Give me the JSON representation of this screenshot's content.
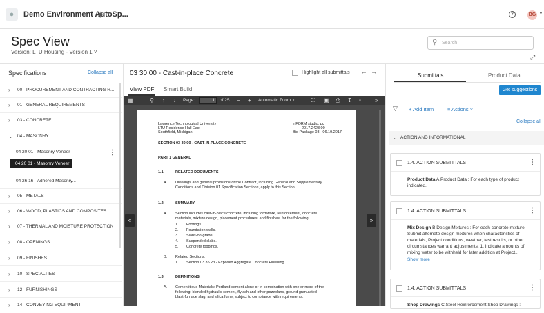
{
  "topbar": {
    "app_title": "Demo Environment AutoSp...",
    "avatar_initials": "BG"
  },
  "page": {
    "title": "Spec View",
    "version": "Version: LTU Housing - Version 1",
    "search_placeholder": "Search"
  },
  "left": {
    "heading": "Specifications",
    "collapse_all": "Collapse all",
    "items": [
      "00 - PROCUREMENT AND CONTRACTING R...",
      "01 - GENERAL REQUIREMENTS",
      "03 - CONCRETE",
      "04 - MASONRY",
      "04 20 01 - Masonry Veneer",
      "04 26 16 - Adhered Masonry...",
      "05 - METALS",
      "06 - WOOD, PLASTICS AND COMPOSITES",
      "07 - THERMAL AND MOISTURE PROTECTION",
      "08 - OPENINGS",
      "09 - FINISHES",
      "10 - SPECIALTIES",
      "12 - FURNISHINGS",
      "14 - CONVEYING EQUIPMENT"
    ],
    "tooltip": "04 20 01 - Masonry Veneer"
  },
  "middle": {
    "doc_title": "03 30 00 - Cast-in-place Concrete",
    "highlight_label": "Highlight all submittals",
    "tab_view": "View PDF",
    "tab_smart": "Smart Build",
    "pdf_toolbar": {
      "page_label": "Page:",
      "page_current": "1",
      "page_total": "of 25",
      "zoom": "Automatic Zoom"
    },
    "pdf": {
      "hdr_left": [
        "Lawrence Technological University",
        "LTU Residence Hall East",
        "Southfield, Michigan"
      ],
      "hdr_right": [
        "inFORM studio, pc",
        "2017.2423.00",
        "Bid Package 03 - 06.19.2017"
      ],
      "section": "SECTION 03 30 00 - CAST-IN-PLACE CONCRETE",
      "part": "PART 1  GENERAL",
      "s11_num": "1.1",
      "s11": "RELATED DOCUMENTS",
      "s11a_l": "A.",
      "s11a": [
        "Drawings and general provisions of the Contract, including General and Supplementary",
        "Conditions and Division 01 Specification Sections, apply to this Section."
      ],
      "s12_num": "1.2",
      "s12": "SUMMARY",
      "s12a_l": "A.",
      "s12a": [
        "Section includes cast-in-place concrete, including formwork, reinforcement, concrete",
        "materials, mixture design, placement procedures, and finishes, for the following:"
      ],
      "list_nums": [
        "1.",
        "2.",
        "3.",
        "4.",
        "5."
      ],
      "list": [
        "Footings.",
        "Foundation walls.",
        "Slabs-on-grade.",
        "Suspended slabs.",
        "Concrete toppings."
      ],
      "s12b_l": "B.",
      "s12b": "Related Sections:",
      "s12b1_n": "1.",
      "s12b1": "Section 03 35 23 - Exposed Aggregate Concrete Finishing",
      "s13_num": "1.3",
      "s13": "DEFINITIONS",
      "s13a_l": "A.",
      "s13a": [
        "Cementitious Materials: Portland cement alone or in combination with one or more of the",
        "following:  blended hydraulic cement, fly ash and other pozzolans, ground granulated",
        "blast-furnace slag, and silica fume; subject to compliance with requirements."
      ]
    }
  },
  "right": {
    "tab_submittals": "Submittals",
    "tab_product": "Product Data",
    "suggest": "Get suggestions",
    "add_item": "+ Add Item",
    "actions": "Actions",
    "collapse_all": "Collapse all",
    "section": "ACTION AND INFORMATIONAL",
    "cards": [
      {
        "title": "1.4. ACTION SUBMITTALS",
        "bold": "Product Data",
        "text": " A.Product Data : For each type of product indicated."
      },
      {
        "title": "1.4. ACTION SUBMITTALS",
        "bold": "Mix Design",
        "text": " B.Design Mixtures : For each concrete mixture. Submit alternate design mixtures when characteristics of materials, Project conditions, weather, test results, or other circumstances warrant adjustments. 1. Indicate amounts of mixing water to be withheld for later addition at Project...",
        "more": "Show more"
      },
      {
        "title": "1.4. ACTION SUBMITTALS",
        "bold": "Shop Drawings",
        "text": " C.Steel Reinforcement Shop Drawings :"
      }
    ]
  }
}
